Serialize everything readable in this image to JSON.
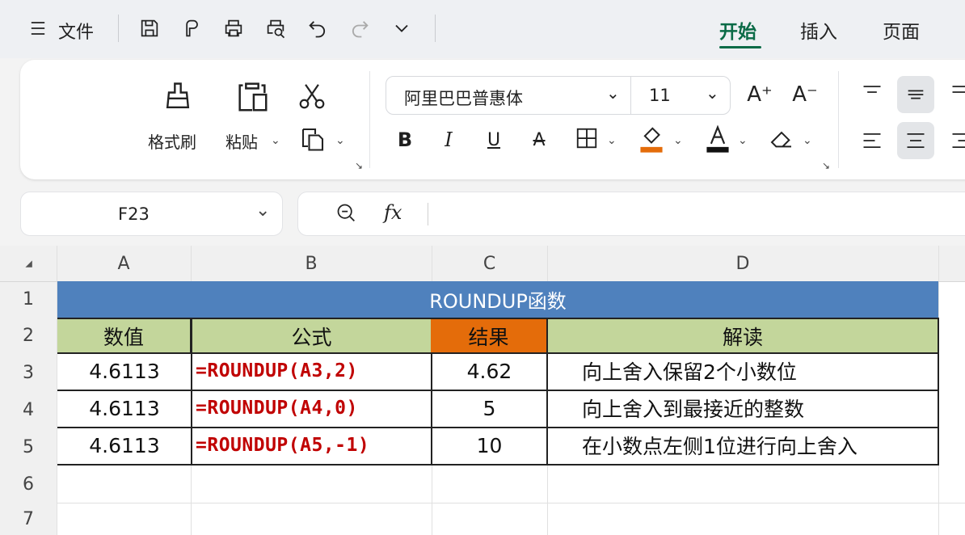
{
  "menu": {
    "file_label": "文件",
    "tabs": [
      {
        "label": "开始",
        "active": true
      },
      {
        "label": "插入",
        "active": false
      },
      {
        "label": "页面",
        "active": false
      }
    ]
  },
  "ribbon": {
    "format_painter_label": "格式刷",
    "paste_label": "粘贴",
    "font_name": "阿里巴巴普惠体",
    "font_size": "11"
  },
  "formula_bar": {
    "name_box": "F23",
    "fx_label": "fx",
    "content": ""
  },
  "sheet": {
    "columns": [
      "A",
      "B",
      "C",
      "D"
    ],
    "rows": [
      "1",
      "2",
      "3",
      "4",
      "5",
      "6",
      "7"
    ],
    "title": "ROUNDUP函数",
    "headers": [
      "数值",
      "公式",
      "结果",
      "解读"
    ],
    "data": [
      {
        "value": "4.6113",
        "formula": "=ROUNDUP(A3,2)",
        "result": "4.62",
        "note": "向上舍入保留2个小数位"
      },
      {
        "value": "4.6113",
        "formula": "=ROUNDUP(A4,0)",
        "result": "5",
        "note": "向上舍入到最接近的整数"
      },
      {
        "value": "4.6113",
        "formula": "=ROUNDUP(A5,-1)",
        "result": "10",
        "note": "在小数点左侧1位进行向上舍入"
      }
    ]
  },
  "colors": {
    "title_bg": "#4f81bd",
    "header_green": "#c3d69b",
    "header_orange": "#e46c0a",
    "formula_red": "#c00000",
    "active_tab": "#0b6b47"
  }
}
